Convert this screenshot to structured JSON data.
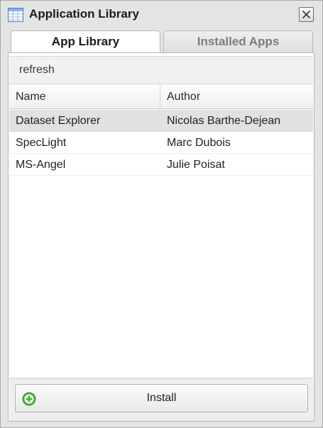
{
  "window": {
    "title": "Application Library",
    "icon": "table-icon",
    "close_icon": "close-icon"
  },
  "tabs": [
    {
      "label": "App Library",
      "active": true
    },
    {
      "label": "Installed Apps",
      "active": false
    }
  ],
  "toolbar": {
    "refresh_label": "refresh"
  },
  "grid": {
    "columns": [
      "Name",
      "Author"
    ],
    "rows": [
      {
        "name": "Dataset Explorer",
        "author": "Nicolas Barthe-Dejean",
        "selected": true
      },
      {
        "name": "SpecLight",
        "author": "Marc Dubois",
        "selected": false
      },
      {
        "name": "MS-Angel",
        "author": "Julie Poisat",
        "selected": false
      }
    ]
  },
  "footer": {
    "install_label": "Install",
    "install_icon": "add-circle-icon"
  },
  "colors": {
    "selected_row": "#e1e1e1",
    "install_icon_green": "#4cae3c",
    "title_icon_blue": "#4f7fc4"
  }
}
